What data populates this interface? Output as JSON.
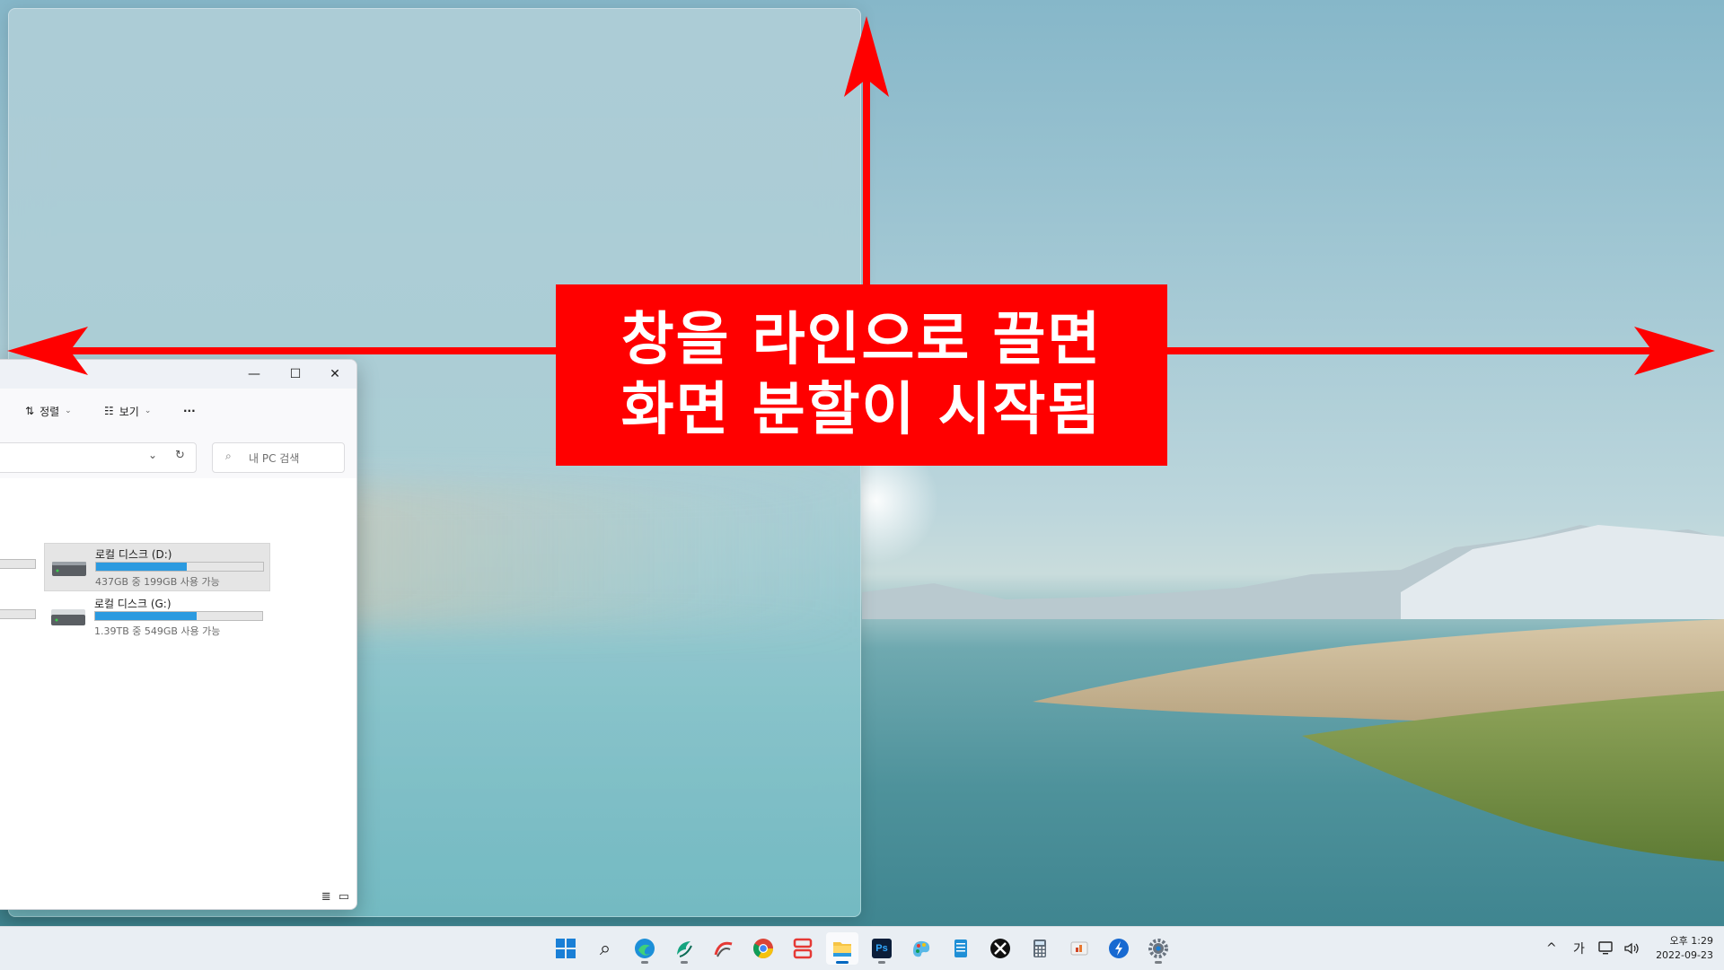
{
  "callout": {
    "line1": "창을 라인으로 끌면",
    "line2": "화면 분할이 시작됨",
    "color": "#ff0000"
  },
  "explorer": {
    "window_controls": {
      "minimize": "—",
      "maximize": "☐",
      "close": "✕"
    },
    "toolbar": {
      "sort_label": "정렬",
      "view_label": "보기",
      "more_label": "···"
    },
    "search_placeholder": "내 PC 검색",
    "drives": [
      {
        "name": "로컬 디스크 (D:)",
        "free_text": "437GB 중 199GB 사용 가능",
        "used_fraction": 0.545,
        "selected": true
      },
      {
        "name": "로컬 디스크 (G:)",
        "free_text": "1.39TB 중 549GB 사용 가능",
        "used_fraction": 0.605,
        "selected": false
      }
    ]
  },
  "taskbar": {
    "icons": [
      "windows-start-icon",
      "search-icon",
      "edge-icon",
      "app-icon",
      "app2-icon",
      "chrome-icon",
      "split-app-icon",
      "file-explorer-icon",
      "photoshop-icon",
      "paint-icon",
      "notepad-icon",
      "xbox-icon",
      "calculator-icon",
      "office-icon",
      "app3-icon",
      "settings-icon"
    ],
    "photoshop_label": "Ps",
    "tray": {
      "chevron": "^",
      "ime": "가"
    },
    "clock": {
      "time": "오후 1:29",
      "date": "2022-09-23"
    },
    "accent": "#0067c0"
  }
}
